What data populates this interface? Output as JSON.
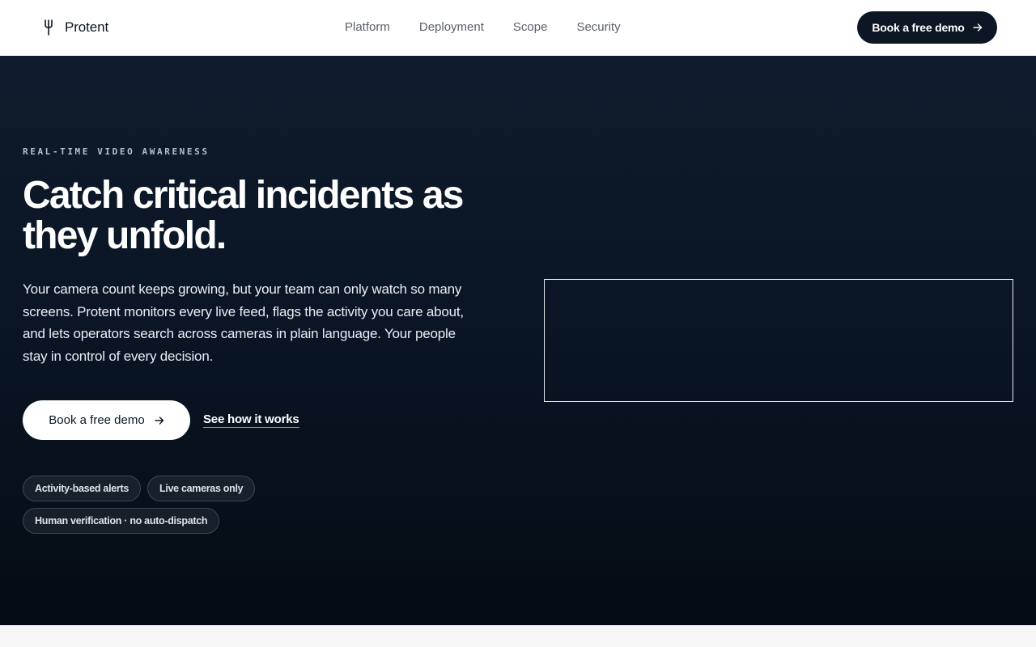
{
  "header": {
    "brand_name": "Protent",
    "brand_icon": "trident-icon",
    "nav": [
      {
        "label": "Platform"
      },
      {
        "label": "Deployment"
      },
      {
        "label": "Scope"
      },
      {
        "label": "Security"
      }
    ],
    "cta_label": "Book a free demo",
    "cta_icon": "arrow-right-icon"
  },
  "hero": {
    "eyebrow": "REAL-TIME VIDEO AWARENESS",
    "headline": "Catch critical incidents as they unfold.",
    "lede": "Your camera count keeps growing, but your team can only watch so many screens. Protent monitors every live feed, flags the activity you care about, and lets operators search across cameras in plain language. Your people stay in control of every decision.",
    "primary_cta": "Book a free demo",
    "secondary_cta": "See how it works",
    "pills": [
      {
        "label": "Activity-based alerts"
      },
      {
        "label": "Live cameras only"
      },
      {
        "label": "Human verification · no auto-dispatch"
      }
    ]
  },
  "colors": {
    "header_bg": "#ffffff",
    "hero_bg_top": "#0e1b2c",
    "hero_bg_bottom": "#050b14",
    "cta_dark": "#0c1624",
    "text_on_dark": "#ffffff"
  }
}
